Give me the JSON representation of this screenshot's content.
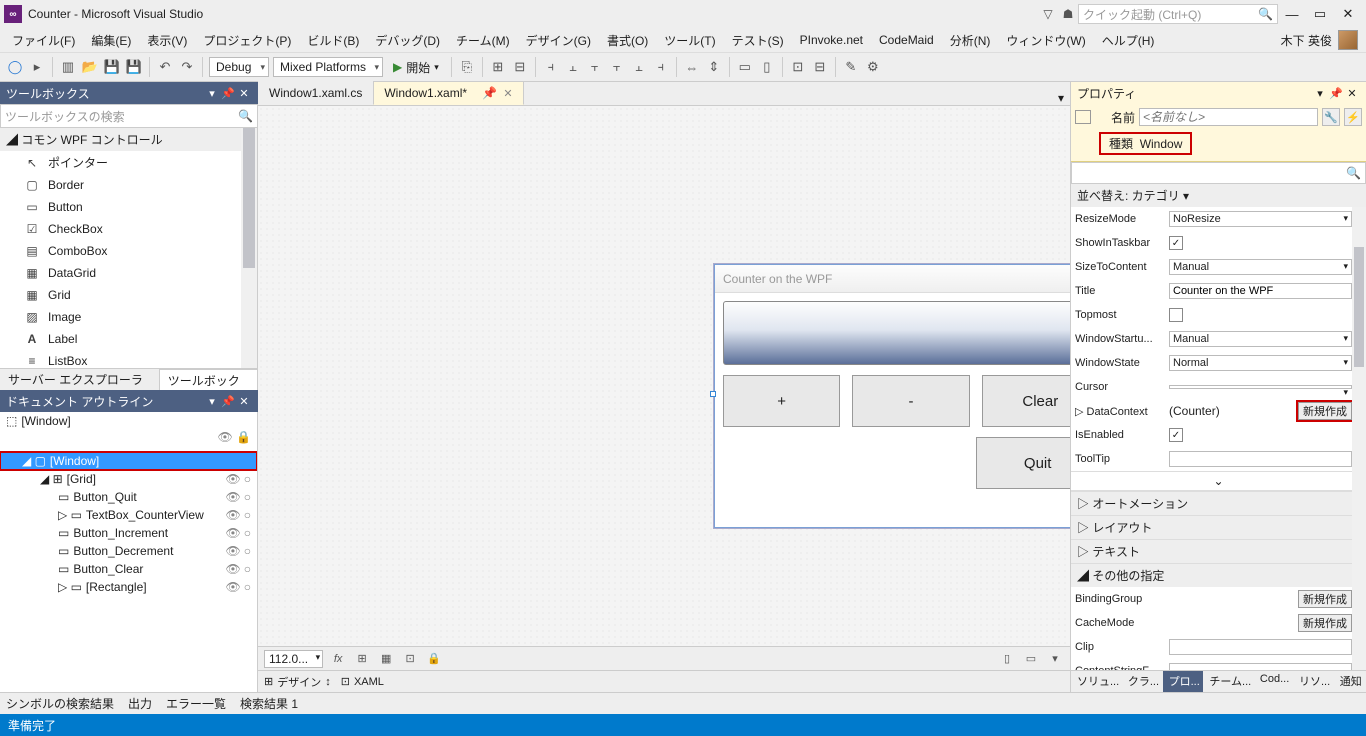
{
  "title": "Counter - Microsoft Visual Studio",
  "quicklaunch_placeholder": "クイック起動 (Ctrl+Q)",
  "user_name": "木下 英俊",
  "menu": [
    "ファイル(F)",
    "編集(E)",
    "表示(V)",
    "プロジェクト(P)",
    "ビルド(B)",
    "デバッグ(D)",
    "チーム(M)",
    "デザイン(G)",
    "書式(O)",
    "ツール(T)",
    "テスト(S)",
    "PInvoke.net",
    "CodeMaid",
    "分析(N)",
    "ウィンドウ(W)",
    "ヘルプ(H)"
  ],
  "toolbar": {
    "config": "Debug",
    "platform": "Mixed Platforms",
    "start": "開始"
  },
  "left": {
    "toolbox_title": "ツールボックス",
    "toolbox_search_placeholder": "ツールボックスの検索",
    "toolbox_category": "コモン WPF コントロール",
    "toolbox_items": [
      "ポインター",
      "Border",
      "Button",
      "CheckBox",
      "ComboBox",
      "DataGrid",
      "Grid",
      "Image",
      "Label",
      "ListBox"
    ],
    "tab_server": "サーバー エクスプローラー",
    "tab_toolbox": "ツールボックス",
    "outline_title": "ドキュメント アウトライン",
    "outline_root_label": "[Window]",
    "outline": {
      "window": "[Window]",
      "grid": "[Grid]",
      "children": [
        "Button_Quit",
        "TextBox_CounterView",
        "Button_Increment",
        "Button_Decrement",
        "Button_Clear",
        "[Rectangle]"
      ]
    }
  },
  "center": {
    "tabs": [
      {
        "label": "Window1.xaml.cs",
        "active": false
      },
      {
        "label": "Window1.xaml*",
        "active": true
      }
    ],
    "wpf": {
      "title": "Counter on the WPF",
      "btn_plus": "+",
      "btn_minus": "-",
      "btn_clear": "Clear",
      "btn_quit": "Quit"
    },
    "zoom": "112.0...",
    "design_tab": "デザイン",
    "xaml_tab": "XAML"
  },
  "right": {
    "title": "プロパティ",
    "name_label": "名前",
    "name_placeholder": "<名前なし>",
    "type_label": "種類",
    "type_value": "Window",
    "sort_label": "並べ替え: カテゴリ ▾",
    "props": {
      "ResizeMode": "NoResize",
      "ShowInTaskbar": true,
      "SizeToContent": "Manual",
      "Title": "Counter on the WPF",
      "Topmost": false,
      "WindowStartupLocation": "Manual",
      "WindowState": "Normal",
      "Cursor": "",
      "DataContext": "(Counter)",
      "DataContext_btn": "新規作成",
      "IsEnabled": true,
      "ToolTip": ""
    },
    "cats": {
      "automation": "オートメーション",
      "layout": "レイアウト",
      "text": "テキスト",
      "other": "その他の指定"
    },
    "other_props": {
      "BindingGroup_btn": "新規作成",
      "CacheMode_btn": "新規作成",
      "Clip": "",
      "ContentStringFormat": ""
    },
    "labels": {
      "ResizeMode": "ResizeMode",
      "ShowInTaskbar": "ShowInTaskbar",
      "SizeToContent": "SizeToContent",
      "Title": "Title",
      "Topmost": "Topmost",
      "WindowStartu": "WindowStartu...",
      "WindowState": "WindowState",
      "Cursor": "Cursor",
      "DataContext": "DataContext",
      "IsEnabled": "IsEnabled",
      "ToolTip": "ToolTip",
      "BindingGroup": "BindingGroup",
      "CacheMode": "CacheMode",
      "Clip": "Clip",
      "ContentStringF": "ContentStringF..."
    },
    "tabs": [
      "ソリュ...",
      "クラ...",
      "プロ...",
      "チーム...",
      "Cod...",
      "リソ...",
      "通知"
    ]
  },
  "bottom": {
    "items": [
      "シンボルの検索結果",
      "出力",
      "エラー一覧",
      "検索結果 1"
    ]
  },
  "status": "準備完了"
}
